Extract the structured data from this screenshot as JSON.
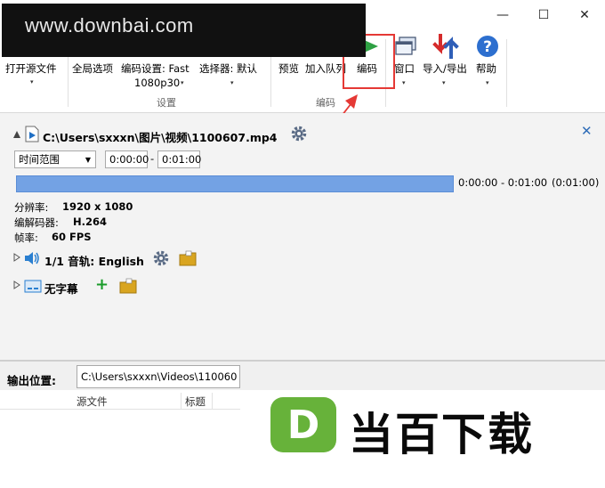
{
  "watermark": {
    "text": "www.downbai.com"
  },
  "window": {
    "minimize": "—",
    "maximize": "☐",
    "close": "✕"
  },
  "ribbon": {
    "open_source": "打开源文件",
    "global_options": "全局选项",
    "encode_settings": "编码设置: Fast",
    "encode_settings_preset": "1080p30",
    "selector": "选择器: 默认",
    "group_settings": "设置",
    "preview": "预览",
    "add_queue": "加入队列",
    "encode": "编码",
    "group_encode": "编码",
    "window": "窗口",
    "import_export": "导入/导出",
    "help": "帮助",
    "caret": "▾"
  },
  "source": {
    "path": "C:\\Users\\sxxxn\\图片\\视频\\1100607.mp4",
    "range_type": "时间范围",
    "start_time": "0:00:00",
    "range_sep": "-",
    "end_time": "0:01:00",
    "range_text": "0:00:00 - 0:01:00",
    "duration_text": "(0:01:00)",
    "resolution_label": "分辨率:",
    "resolution": "1920 x 1080",
    "codec_label": "编解码器:",
    "codec": "H.264",
    "fps_label": "帧率:",
    "fps": "60 FPS",
    "audio_track": "1/1 音轨: English",
    "subtitle": "无字幕",
    "add": "+"
  },
  "output": {
    "label": "输出位置:",
    "path": "C:\\Users\\sxxxn\\Videos\\110060",
    "col_source": "源文件",
    "col_title": "标题"
  },
  "brand": {
    "logo_letter": "D",
    "logo_text": "当百下载"
  },
  "colors": {
    "accent": "#73a2e4",
    "annotation": "#e53935",
    "logo_green": "#67b23a"
  }
}
